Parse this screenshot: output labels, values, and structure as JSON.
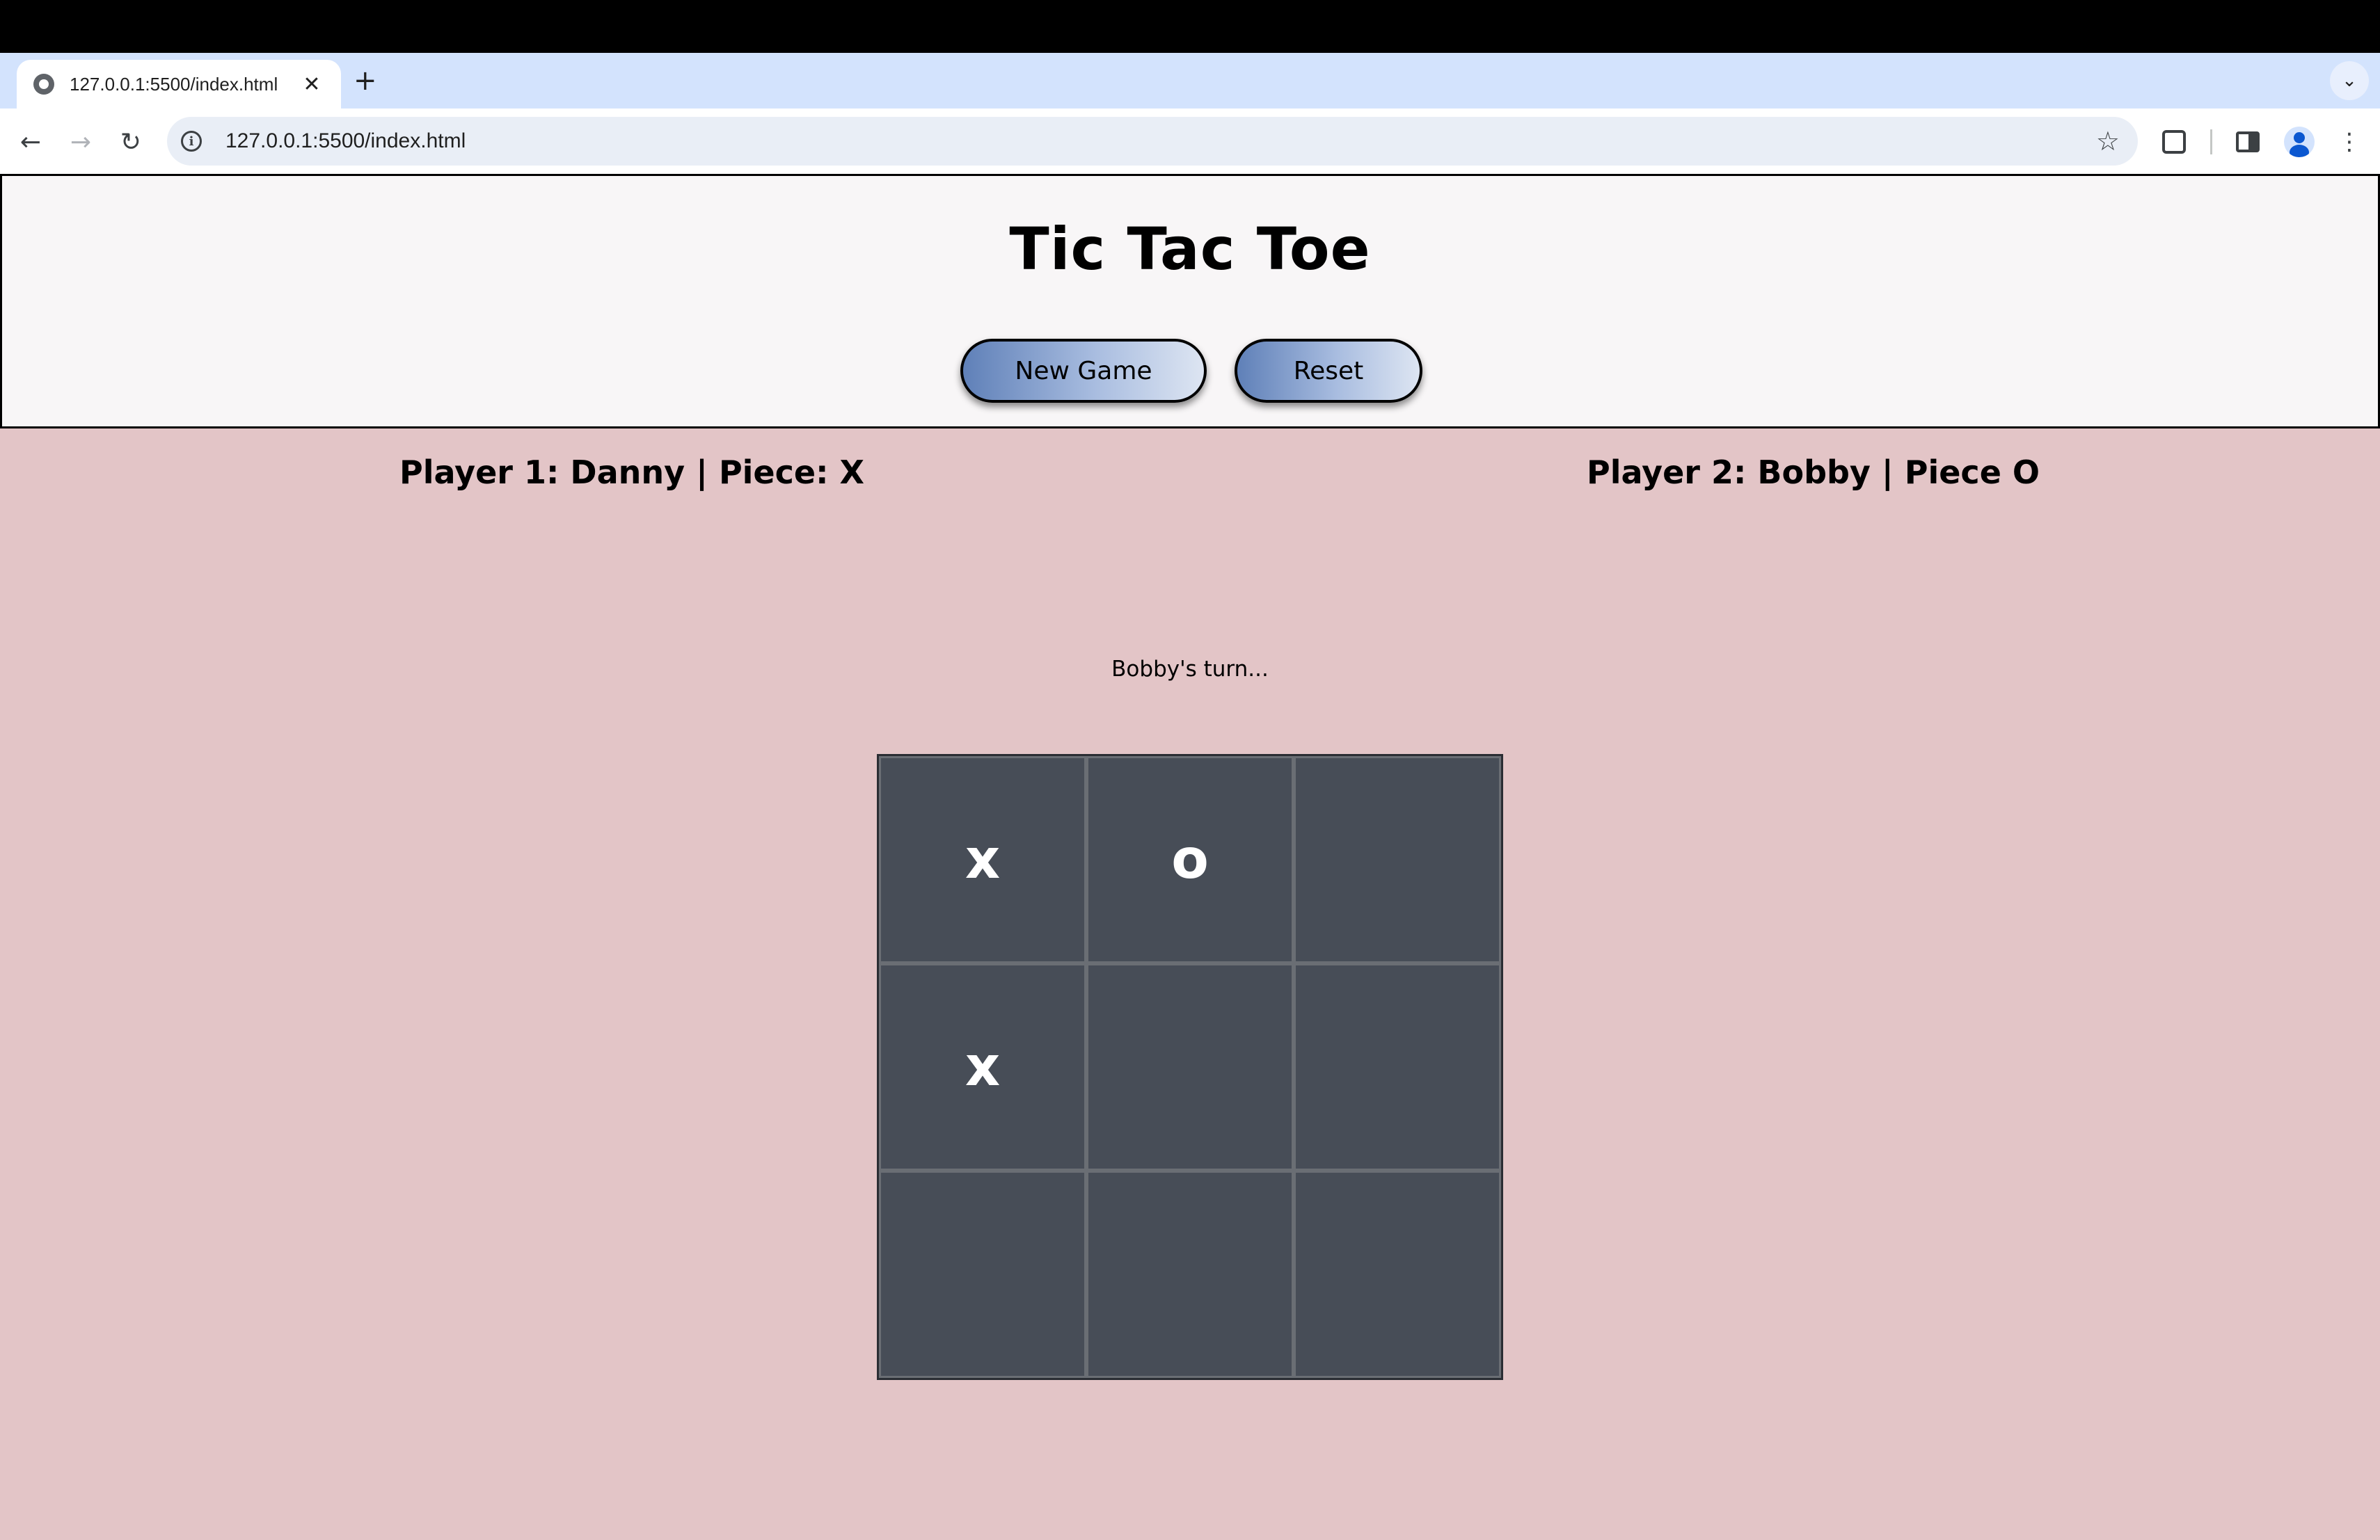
{
  "browser": {
    "tab_title": "127.0.0.1:5500/index.html",
    "tab_close": "✕",
    "new_tab": "+",
    "tab_search": "⌄",
    "back": "←",
    "forward": "→",
    "reload": "↻",
    "info": "i",
    "url": "127.0.0.1:5500/index.html",
    "bookmark": "☆",
    "menu": "⋮"
  },
  "header": {
    "title": "Tic Tac Toe",
    "new_game_label": "New Game",
    "reset_label": "Reset"
  },
  "players": {
    "player1": "Player 1: Danny | Piece: X",
    "player2": "Player 2: Bobby | Piece O"
  },
  "status": {
    "turn_text": "Bobby's turn..."
  },
  "board": {
    "cells": [
      "x",
      "o",
      "",
      "x",
      "",
      "",
      "",
      "",
      ""
    ]
  },
  "colors": {
    "page_bg": "#e3c5c7",
    "header_bg": "#f8f6f7",
    "cell_bg": "#474d57",
    "button_gradient_start": "#5f80b8",
    "button_gradient_end": "#dde5f2"
  }
}
